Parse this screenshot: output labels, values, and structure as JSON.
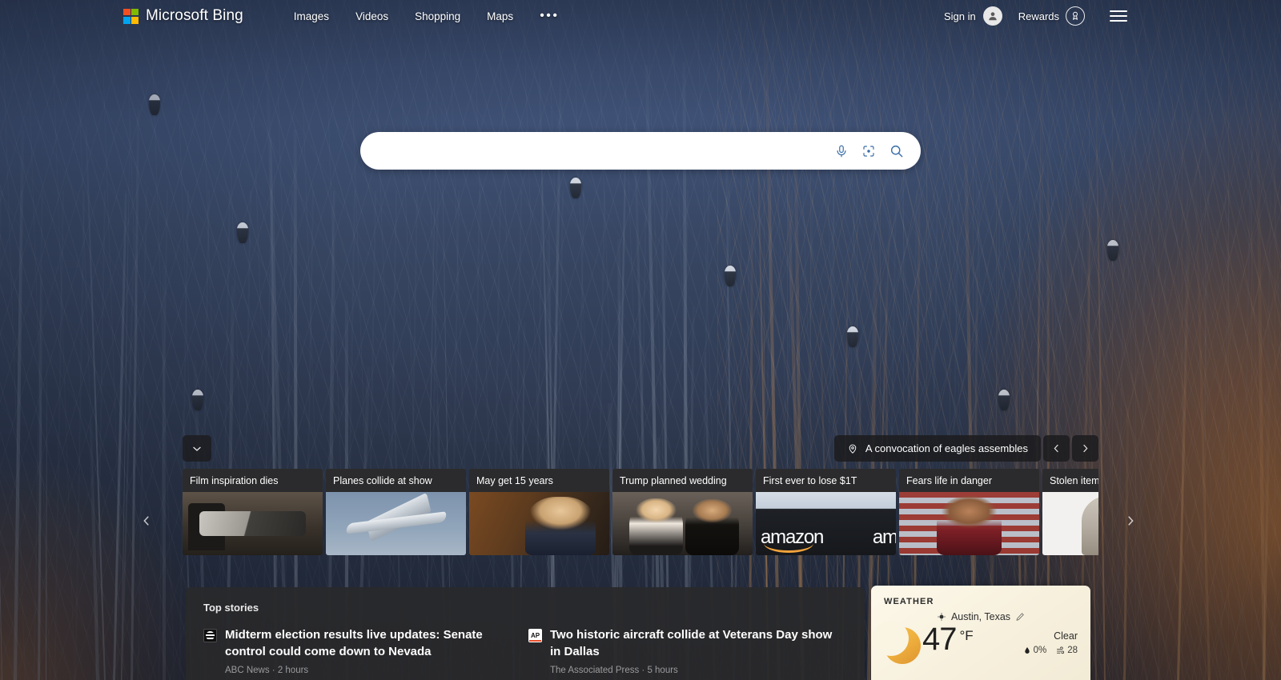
{
  "header": {
    "brand_name": "Microsoft Bing",
    "logo_icon": "microsoft-logo-icon",
    "nav": [
      {
        "label": "Images"
      },
      {
        "label": "Videos"
      },
      {
        "label": "Shopping"
      },
      {
        "label": "Maps"
      }
    ],
    "more_label": "•••",
    "sign_in_label": "Sign in",
    "account_icon": "person-icon",
    "rewards_label": "Rewards",
    "rewards_icon": "rewards-medal-icon",
    "menu_icon": "hamburger-menu-icon"
  },
  "search": {
    "value": "",
    "placeholder": "",
    "mic_icon": "microphone-icon",
    "visual_search_icon": "visual-search-camera-icon",
    "search_icon": "magnifier-icon"
  },
  "hero": {
    "caption": "A convocation of eagles assembles",
    "location_icon": "location-pin-icon",
    "prev_icon": "chevron-left-icon",
    "next_icon": "chevron-right-icon",
    "scroll_down_icon": "chevron-down-icon"
  },
  "carousel": {
    "prev_icon": "chevron-left-icon",
    "next_icon": "chevron-right-icon",
    "cards": [
      {
        "title": "Film inspiration dies",
        "image": "man-reclining-in-chair"
      },
      {
        "title": "Planes collide at show",
        "image": "vintage-bomber-aircraft"
      },
      {
        "title": "May get 15 years",
        "image": "blonde-woman-in-courtroom"
      },
      {
        "title": "Trump planned wedding",
        "image": "couple-on-red-carpet"
      },
      {
        "title": "First ever to lose $1T",
        "image": "amazon-storefront-sign"
      },
      {
        "title": "Fears life in danger",
        "image": "congresswoman-at-podium"
      },
      {
        "title": "Stolen item",
        "image": "stone-statue"
      }
    ]
  },
  "top_stories": {
    "heading": "Top stories",
    "stories": [
      {
        "favicon": "abc-news-icon",
        "title": "Midterm election results live updates: Senate control could come down to Nevada",
        "meta": "ABC News · 2 hours"
      },
      {
        "favicon": "associated-press-icon",
        "title": "Two historic aircraft collide at Veterans Day show in Dallas",
        "meta": "The Associated Press · 5 hours"
      }
    ]
  },
  "weather": {
    "label": "WEATHER",
    "location": "Austin, Texas",
    "location_icon": "location-target-icon",
    "edit_icon": "pencil-edit-icon",
    "condition_icon": "crescent-moon-icon",
    "temperature": "47",
    "unit": "°F",
    "condition": "Clear",
    "precipitation": "0%",
    "precipitation_icon": "raindrop-icon",
    "air_quality": "28",
    "air_quality_icon": "air-quality-icon"
  },
  "colors": {
    "accent": "#3b6ea8",
    "panel": "#292 92b",
    "weather_card": "#faf4e3"
  }
}
